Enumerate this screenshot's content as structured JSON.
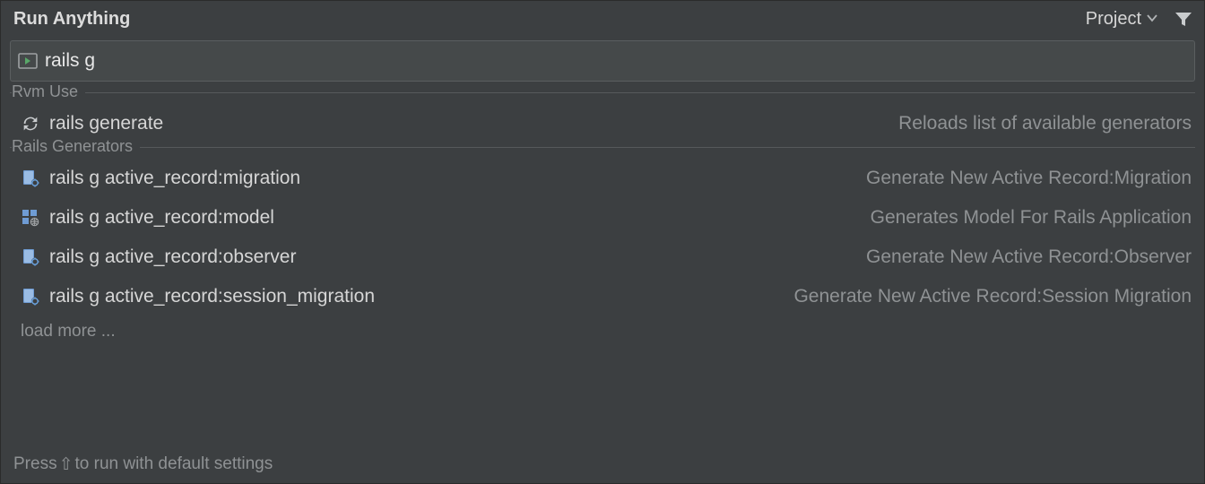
{
  "header": {
    "title": "Run Anything",
    "scope_label": "Project"
  },
  "search": {
    "value": "rails g"
  },
  "sections": [
    {
      "label": "Rvm Use",
      "items": [
        {
          "icon": "refresh",
          "command": "rails generate",
          "description": "Reloads list of available generators"
        }
      ]
    },
    {
      "label": "Rails Generators",
      "items": [
        {
          "icon": "file-gear",
          "command": "rails g active_record:migration",
          "description": "Generate New Active Record:Migration"
        },
        {
          "icon": "globe-file",
          "command": "rails g active_record:model",
          "description": "Generates Model For Rails Application"
        },
        {
          "icon": "file-gear",
          "command": "rails g active_record:observer",
          "description": "Generate New Active Record:Observer"
        },
        {
          "icon": "file-gear",
          "command": "rails g active_record:session_migration",
          "description": "Generate New Active Record:Session Migration"
        }
      ],
      "load_more": "load more ..."
    }
  ],
  "footer": {
    "prefix": "Press ",
    "key_glyph": "⇧",
    "suffix": " to run with default settings"
  }
}
